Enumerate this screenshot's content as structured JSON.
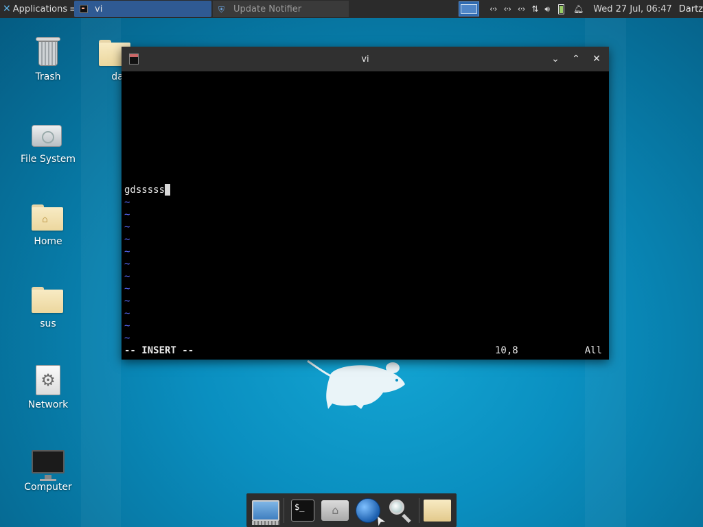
{
  "top_panel": {
    "applications_label": "Applications",
    "tasks": [
      {
        "label": "vi",
        "icon": "terminal-icon",
        "active": true
      },
      {
        "label": "Update Notifier",
        "icon": "shield-icon",
        "active": false
      }
    ],
    "tray_icons": [
      "network-icon",
      "network-icon",
      "network-icon",
      "transfer-icon",
      "volume-icon",
      "battery-icon",
      "bell-icon"
    ],
    "clock": "Wed 27 Jul, 06:47",
    "user": "Dartz"
  },
  "desktop": {
    "icons": [
      {
        "label": "Trash",
        "icon": "trash-icon"
      },
      {
        "label": "File System",
        "icon": "drive-icon"
      },
      {
        "label": "Home",
        "icon": "home-folder-icon"
      },
      {
        "label": "sus",
        "icon": "folder-icon"
      },
      {
        "label": "Network",
        "icon": "network-settings-icon"
      },
      {
        "label": "Computer",
        "icon": "computer-icon"
      },
      {
        "label": "da",
        "icon": "folder-icon"
      }
    ]
  },
  "vi_window": {
    "title": "vi",
    "buffer_line": "gdsssss",
    "tilde_lines": [
      "~",
      "~",
      "~",
      "~",
      "~",
      "~",
      "~",
      "~",
      "~",
      "~",
      "~",
      "~"
    ],
    "mode": "-- INSERT --",
    "position": "10,8",
    "scroll": "All"
  },
  "dock": {
    "items": [
      "show-desktop-icon",
      "terminal-icon",
      "home-folder-icon",
      "web-browser-icon",
      "search-icon",
      "folder-icon"
    ]
  },
  "colors": {
    "panel_bg": "#2b2b2b",
    "active_task": "#2f5a93",
    "desktop_bg": "#0a8fc0",
    "tilde": "#5a6cff"
  }
}
